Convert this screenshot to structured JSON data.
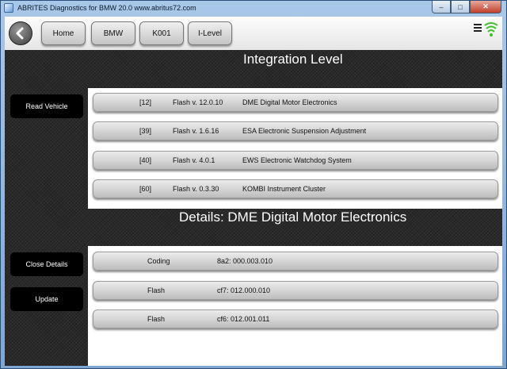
{
  "window": {
    "title": "ABRITES Diagnostics for BMW 20.0   www.abritus72.com"
  },
  "toolbar": {
    "buttons": [
      "Home",
      "BMW",
      "K001",
      "I-Level"
    ]
  },
  "integration": {
    "title": "Integration Level",
    "read_button": "Read Vehicle",
    "rows": [
      {
        "id": "[12]",
        "flash": "Flash v. 12.0.10",
        "name": "DME Digital Motor Electronics"
      },
      {
        "id": "[39]",
        "flash": "Flash v. 1.6.16",
        "name": "ESA Electronic Suspension Adjustment"
      },
      {
        "id": "[40]",
        "flash": "Flash v. 4.0.1",
        "name": "EWS Electronic Watchdog System"
      },
      {
        "id": "[60]",
        "flash": "Flash v. 0.3.30",
        "name": "KOMBI Instrument Cluster"
      }
    ]
  },
  "details": {
    "title": "Details: DME Digital Motor Electronics",
    "close_button": "Close Details",
    "update_button": "Update",
    "rows": [
      {
        "label": "Coding",
        "value": "8a2: 000.003.010"
      },
      {
        "label": "Flash",
        "value": "cf7: 012.000.010"
      },
      {
        "label": "Flash",
        "value": "cf6: 012.001.011"
      }
    ]
  },
  "icons": {
    "back": "back-arrow-icon",
    "menu": "hamburger-menu-icon",
    "signal": "signal-strength-icon"
  },
  "colors": {
    "signal_green": "#3cbf2a",
    "dark_background": "#2a2a2a"
  }
}
